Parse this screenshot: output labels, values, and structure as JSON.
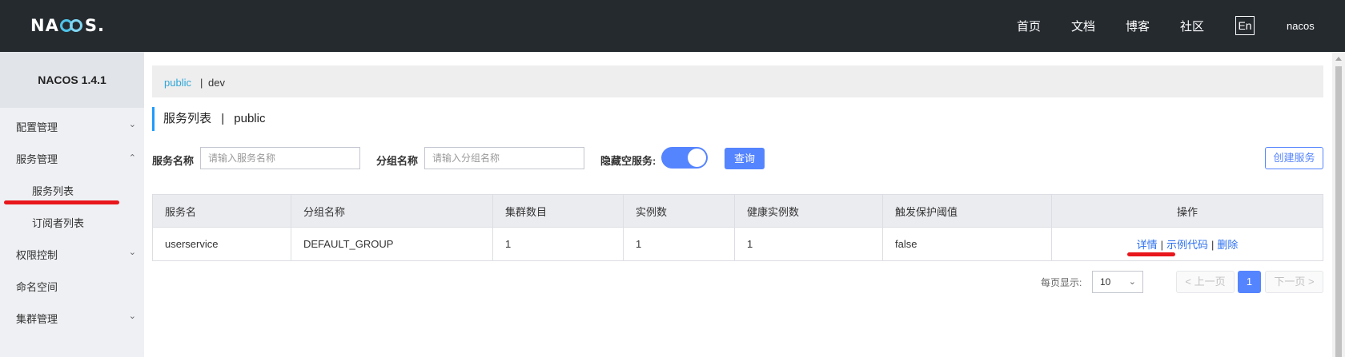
{
  "header": {
    "logo_text_left": "NA",
    "logo_text_right": "S.",
    "nav": [
      "首页",
      "文档",
      "博客",
      "社区"
    ],
    "lang": "En",
    "user": "nacos"
  },
  "sidebar": {
    "version": "NACOS 1.4.1",
    "items": [
      {
        "label": "配置管理",
        "chevron": "chevron-down"
      },
      {
        "label": "服务管理",
        "chevron": "chevron-up"
      },
      {
        "label": "服务列表"
      },
      {
        "label": "订阅者列表"
      },
      {
        "label": "权限控制",
        "chevron": "chevron-down"
      },
      {
        "label": "命名空间"
      },
      {
        "label": "集群管理",
        "chevron": "chevron-down"
      }
    ]
  },
  "namespace": {
    "current": "public",
    "separator": "|",
    "other": "dev"
  },
  "page": {
    "title": "服务列表",
    "title_sep": "|",
    "title_ns": "public"
  },
  "search": {
    "service_label": "服务名称",
    "service_placeholder": "请输入服务名称",
    "group_label": "分组名称",
    "group_placeholder": "请输入分组名称",
    "hide_empty_label": "隐藏空服务:",
    "hide_empty_on": true,
    "query_button": "查询",
    "create_button": "创建服务"
  },
  "table": {
    "headers": [
      "服务名",
      "分组名称",
      "集群数目",
      "实例数",
      "健康实例数",
      "触发保护阈值",
      "操作"
    ],
    "rows": [
      {
        "name": "userservice",
        "group": "DEFAULT_GROUP",
        "clusters": "1",
        "instances": "1",
        "healthy": "1",
        "threshold": "false",
        "actions": [
          "详情",
          "示例代码",
          "删除"
        ]
      }
    ]
  },
  "pagination": {
    "page_size_label": "每页显示:",
    "page_size": "10",
    "prev": "< 上一页",
    "current": "1",
    "next": "下一页 >"
  },
  "colors": {
    "topbar": "#252a2f",
    "accent": "#5584ff",
    "link": "#2ea5d8",
    "annotation_red": "#e8171c"
  }
}
